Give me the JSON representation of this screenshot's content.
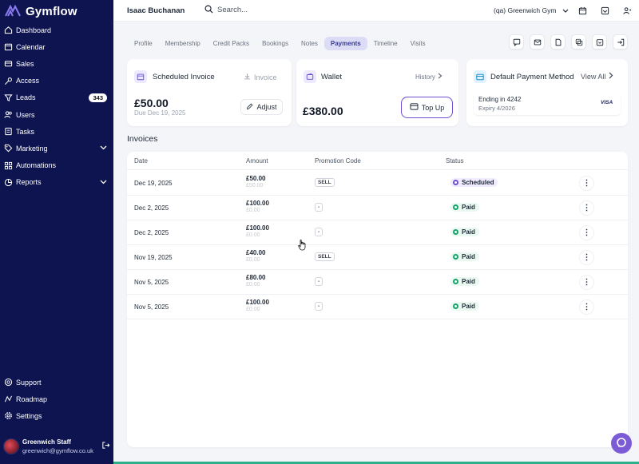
{
  "brand": {
    "name": "Gymflow"
  },
  "sidebar": {
    "items": [
      {
        "label": "Dashboard",
        "icon": "home-icon"
      },
      {
        "label": "Calendar",
        "icon": "calendar-icon"
      },
      {
        "label": "Sales",
        "icon": "sales-icon"
      },
      {
        "label": "Access",
        "icon": "key-icon"
      },
      {
        "label": "Leads",
        "icon": "funnel-icon",
        "badge": "343"
      },
      {
        "label": "Users",
        "icon": "users-icon"
      },
      {
        "label": "Tasks",
        "icon": "tasks-icon"
      },
      {
        "label": "Marketing",
        "icon": "tag-icon",
        "expandable": true
      },
      {
        "label": "Automations",
        "icon": "automation-icon"
      },
      {
        "label": "Reports",
        "icon": "reports-icon",
        "expandable": true
      }
    ],
    "bottom_items": [
      {
        "label": "Support",
        "icon": "support-icon"
      },
      {
        "label": "Roadmap",
        "icon": "roadmap-icon"
      },
      {
        "label": "Settings",
        "icon": "settings-icon"
      }
    ],
    "staff": {
      "name": "Greenwich Staff",
      "email": "greenwich@gymflow.co.uk"
    }
  },
  "header": {
    "member_name": "Isaac Buchanan",
    "search_placeholder": "Search...",
    "gym": "(qa) Greenwich Gym"
  },
  "tabs": [
    {
      "label": "Profile",
      "active": false
    },
    {
      "label": "Membership",
      "active": false
    },
    {
      "label": "Credit Packs",
      "active": false
    },
    {
      "label": "Bookings",
      "active": false
    },
    {
      "label": "Notes",
      "active": false
    },
    {
      "label": "Payments",
      "active": true
    },
    {
      "label": "Timeline",
      "active": false
    },
    {
      "label": "Visits",
      "active": false
    }
  ],
  "cards": {
    "scheduled": {
      "title": "Scheduled Invoice",
      "link": "Invoice",
      "amount": "£50.00",
      "due": "Due Dec 19, 2025",
      "button": "Adjust"
    },
    "wallet": {
      "title": "Wallet",
      "link": "History",
      "amount": "£380.00",
      "button": "Top Up"
    },
    "payment": {
      "title": "Default Payment Method",
      "link": "View All",
      "ending": "Ending in 4242",
      "expiry": "Expiry 4/2026",
      "brand": "VISA"
    }
  },
  "invoices": {
    "title": "Invoices",
    "columns": [
      "Date",
      "Amount",
      "Promotion Code",
      "Status"
    ],
    "rows": [
      {
        "date": "Dec 19, 2025",
        "amount": "£50.00",
        "sub": "£50.00",
        "promo": "SELL",
        "status": "Scheduled"
      },
      {
        "date": "Dec 2, 2025",
        "amount": "£100.00",
        "sub": "£0.00",
        "promo": "-",
        "status": "Paid"
      },
      {
        "date": "Dec 2, 2025",
        "amount": "£100.00",
        "sub": "£0.00",
        "promo": "-",
        "status": "Paid"
      },
      {
        "date": "Nov 19, 2025",
        "amount": "£40.00",
        "sub": "£0.00",
        "promo": "SELL",
        "status": "Paid"
      },
      {
        "date": "Nov 5, 2025",
        "amount": "£80.00",
        "sub": "£0.00",
        "promo": "-",
        "status": "Paid"
      },
      {
        "date": "Nov 5, 2025",
        "amount": "£100.00",
        "sub": "£0.00",
        "promo": "-",
        "status": "Paid"
      }
    ]
  },
  "colors": {
    "sidebar_bg": "#0d1450",
    "accent": "#6d4fd0",
    "paid": "#16a36a",
    "scheduled": "#6d4fd0",
    "tab_active_bg": "#dcdcf7"
  }
}
